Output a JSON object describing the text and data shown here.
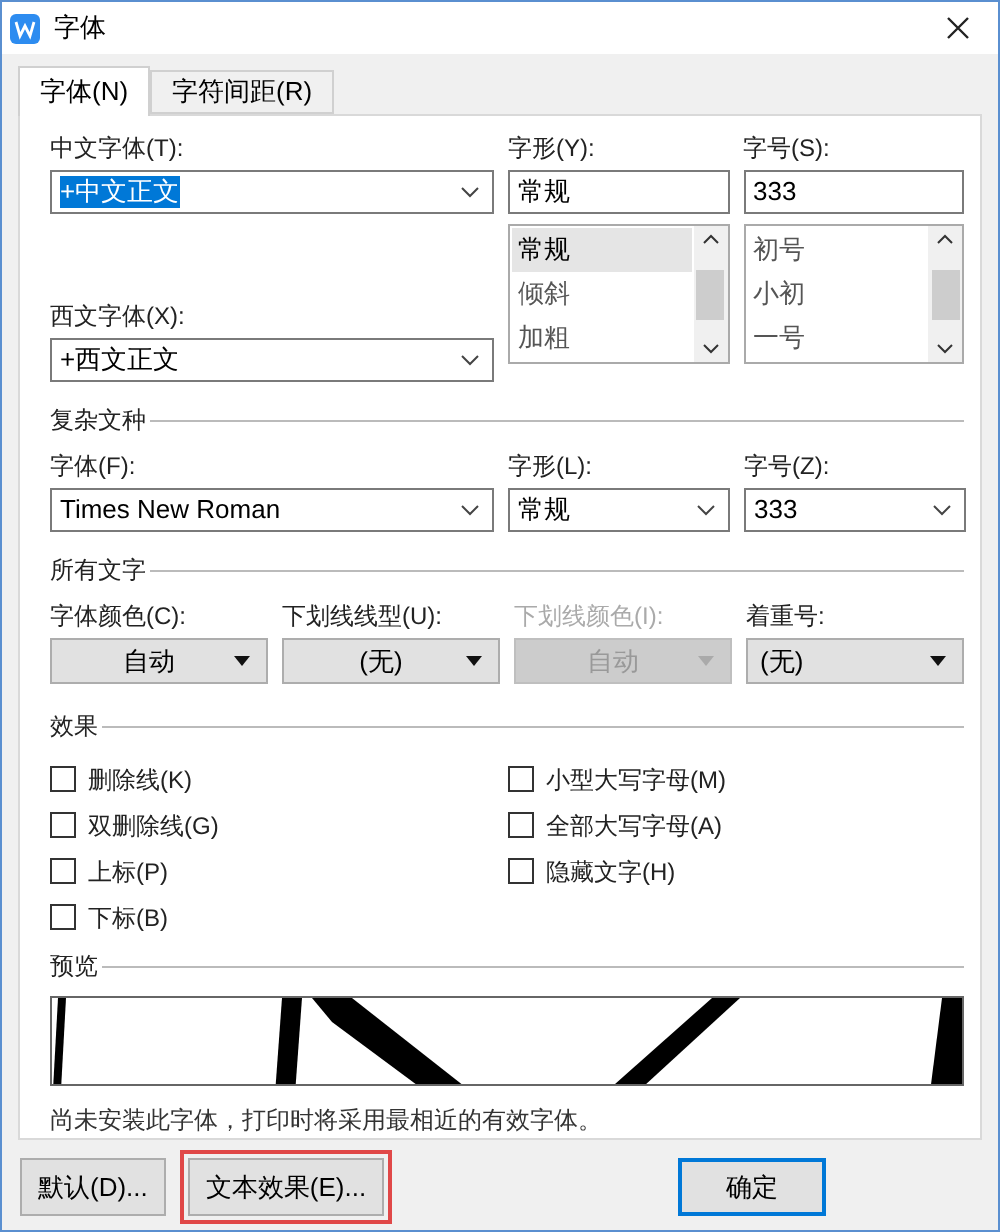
{
  "window": {
    "title": "字体"
  },
  "tabs": [
    {
      "label": "字体(N)",
      "selected": true
    },
    {
      "label": "字符间距(R)",
      "selected": false
    }
  ],
  "chinese_font": {
    "label": "中文字体(T):",
    "value": "+中文正文"
  },
  "western_font": {
    "label": "西文字体(X):",
    "value": "+西文正文"
  },
  "style": {
    "label": "字形(Y):",
    "value": "常规",
    "options": [
      {
        "label": "常规",
        "selected": true
      },
      {
        "label": "倾斜",
        "selected": false
      },
      {
        "label": "加粗",
        "selected": false
      }
    ]
  },
  "size": {
    "label": "字号(S):",
    "value": "333",
    "options": [
      {
        "label": "初号",
        "selected": false
      },
      {
        "label": "小初",
        "selected": false
      },
      {
        "label": "一号",
        "selected": false
      }
    ]
  },
  "complex_script": {
    "title": "复杂文种",
    "fields": [
      {
        "label": "字体(F):",
        "value": "Times New Roman"
      },
      {
        "label": "字形(L):",
        "value": "常规"
      },
      {
        "label": "字号(Z):",
        "value": "333"
      }
    ]
  },
  "all_text": {
    "title": "所有文字",
    "fields": [
      {
        "label": "字体颜色(C):",
        "value": "自动",
        "disabled": false
      },
      {
        "label": "下划线线型(U):",
        "value": "(无)",
        "disabled": false
      },
      {
        "label": "下划线颜色(I):",
        "value": "自动",
        "disabled": true
      },
      {
        "label": "着重号:",
        "value": "(无)",
        "disabled": false
      }
    ]
  },
  "effects": {
    "title": "效果",
    "left": [
      {
        "label": "删除线(K)",
        "checked": false
      },
      {
        "label": "双删除线(G)",
        "checked": false
      },
      {
        "label": "上标(P)",
        "checked": false
      },
      {
        "label": "下标(B)",
        "checked": false
      }
    ],
    "right": [
      {
        "label": "小型大写字母(M)",
        "checked": false
      },
      {
        "label": "全部大写字母(A)",
        "checked": false
      },
      {
        "label": "隐藏文字(H)",
        "checked": false
      }
    ]
  },
  "preview": {
    "title": "预览",
    "note": "尚未安装此字体，打印时将采用最相近的有效字体。"
  },
  "buttons": [
    {
      "label": "默认(D)...",
      "highlighted": false,
      "default": false
    },
    {
      "label": "文本效果(E)...",
      "highlighted": true,
      "default": false
    },
    {
      "label": "确定",
      "highlighted": false,
      "default": true
    }
  ]
}
